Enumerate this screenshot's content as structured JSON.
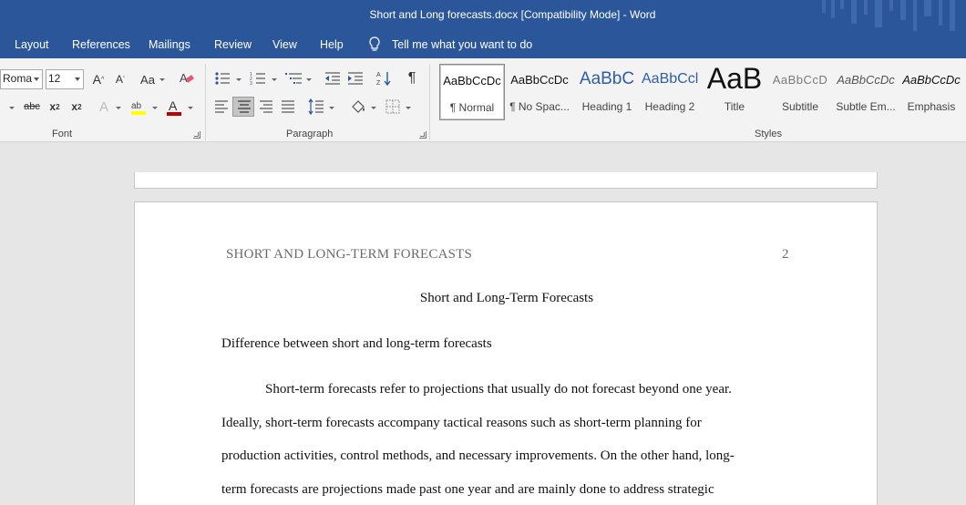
{
  "window": {
    "title": "Short and Long forecasts.docx [Compatibility Mode]  -  Word"
  },
  "menu": {
    "tabs": [
      "Layout",
      "References",
      "Mailings",
      "Review",
      "View",
      "Help"
    ],
    "tell_me": "Tell me what you want to do"
  },
  "ribbon": {
    "font": {
      "name": "Roma",
      "size": "12",
      "group_label": "Font"
    },
    "paragraph": {
      "group_label": "Paragraph"
    },
    "styles": {
      "group_label": "Styles",
      "items": [
        {
          "preview": "AaBbCcDc",
          "name": "¶ Normal",
          "selected": true
        },
        {
          "preview": "AaBbCcDc",
          "name": "¶ No Spac..."
        },
        {
          "preview": "AaBbC",
          "name": "Heading 1"
        },
        {
          "preview": "AaBbCcl",
          "name": "Heading 2"
        },
        {
          "preview": "AaB",
          "name": "Title"
        },
        {
          "preview": "AaBbCcD",
          "name": "Subtitle"
        },
        {
          "preview": "AaBbCcDc",
          "name": "Subtle Em..."
        },
        {
          "preview": "AaBbCcDc",
          "name": "Emphasis"
        }
      ]
    },
    "colors": {
      "highlight": "#ffff00",
      "font_color": "#c00000"
    }
  },
  "document": {
    "running_head": "SHORT AND LONG-TERM FORECASTS",
    "page_number": "2",
    "title": "Short and Long-Term Forecasts",
    "heading": "Difference between short and long-term forecasts",
    "lines": [
      "Short-term forecasts refer to projections that usually do not forecast beyond one year.",
      "Ideally, short-term forecasts accompany tactical reasons such as short-term planning for",
      "production activities, control methods, and necessary improvements. On the other hand, long-",
      "term forecasts are projections made past one year and are mainly done to address strategic"
    ]
  },
  "colors": {
    "accent": "#2b579a",
    "ribbon": "#f3f3f3",
    "canvas": "#e6e6e6"
  }
}
